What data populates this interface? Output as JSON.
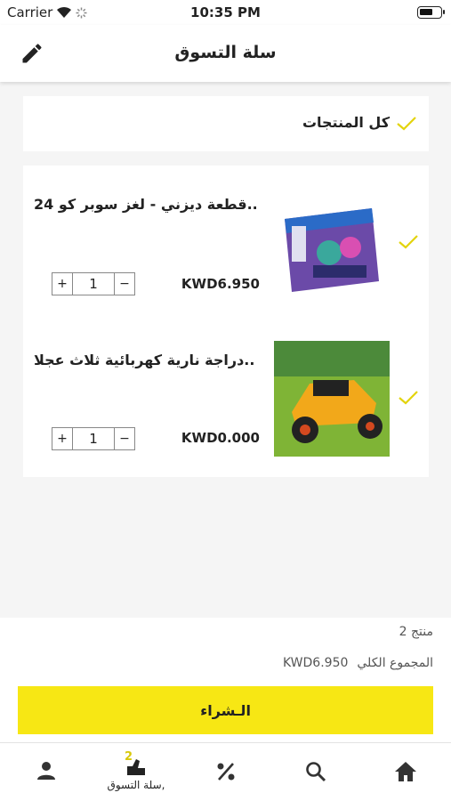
{
  "status_bar": {
    "carrier": "Carrier",
    "time": "10:35 PM"
  },
  "header": {
    "title": "سلة التسوق"
  },
  "select_all": {
    "label": "كل المنتجات"
  },
  "items": [
    {
      "name": "24 قطعة ديزني - لغز سوبر كو...",
      "price": "KWD6.950",
      "quantity": "1",
      "plus": "+",
      "minus": "−"
    },
    {
      "name": "دراجة نارية كهربائية ثلاث عجلا...",
      "price": "KWD0.000",
      "quantity": "1",
      "plus": "+",
      "minus": "−"
    }
  ],
  "summary": {
    "count": "2 منتج",
    "total_label": "المجموع الكلي",
    "total_value": "KWD6.950"
  },
  "checkout": {
    "label": "الـشراء"
  },
  "tabs": {
    "cart_label": "سلة التسوق,",
    "cart_badge": "2"
  },
  "colors": {
    "accent": "#f7e714",
    "check": "#e3d40c"
  }
}
